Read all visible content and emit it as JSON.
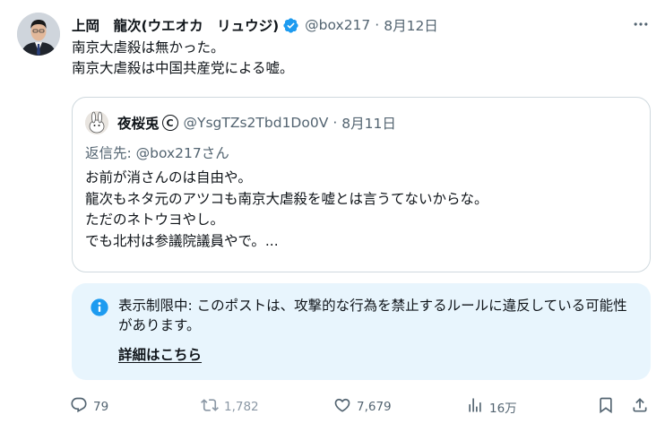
{
  "tweet": {
    "author_name": "上岡　龍次(ウエオカ　リュウジ)",
    "handle": "@box217",
    "separator": "·",
    "date": "8月12日",
    "text_lines": [
      "南京大虐殺は無かった。",
      "南京大虐殺は中国共産党による嘘。"
    ]
  },
  "quote": {
    "author_name": "夜桜兎",
    "copyright_mark": "C",
    "handle": "@YsgTZs2Tbd1Do0V",
    "separator": "·",
    "date": "8月11日",
    "reply_to": "返信先: @box217さん",
    "text_lines": [
      "お前が消さんのは自由や。",
      "龍次もネタ元のアツコも南京大虐殺を嘘とは言うてないからな。",
      "ただのネトウヨやし。",
      "でも北村は参議院議員やで。..."
    ]
  },
  "notice": {
    "text": "表示制限中: このポストは、攻撃的な行為を禁止するルールに違反している可能性があります。",
    "link_label": "詳細はこちら"
  },
  "actions": {
    "replies": "79",
    "reposts": "1,782",
    "likes": "7,679",
    "views": "16万"
  },
  "colors": {
    "verified": "#1d9bf0",
    "notice_bg": "#e8f5fd",
    "secondary_text": "#536471"
  },
  "icons": [
    "verified-badge-icon",
    "more-icon",
    "info-icon",
    "reply-icon",
    "repost-icon",
    "like-icon",
    "views-icon",
    "bookmark-icon",
    "share-icon"
  ]
}
